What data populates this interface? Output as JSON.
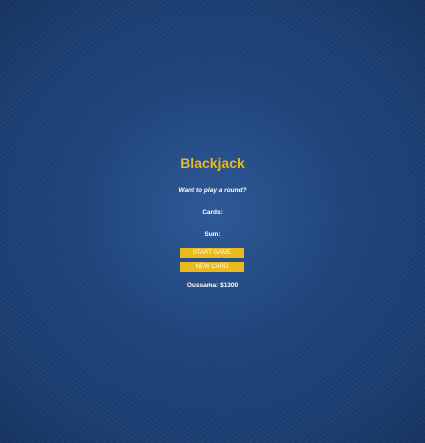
{
  "game": {
    "title": "Blackjack",
    "message": "Want to play a round?",
    "cards_label": "Cards:",
    "sum_label": "Sum:",
    "start_button": "START GAME",
    "new_card_button": "NEW CARD",
    "player_info": "Oussama: $1300"
  },
  "colors": {
    "accent": "#e9b91e",
    "text": "#ffffff",
    "table_background": "#1c3f73"
  }
}
